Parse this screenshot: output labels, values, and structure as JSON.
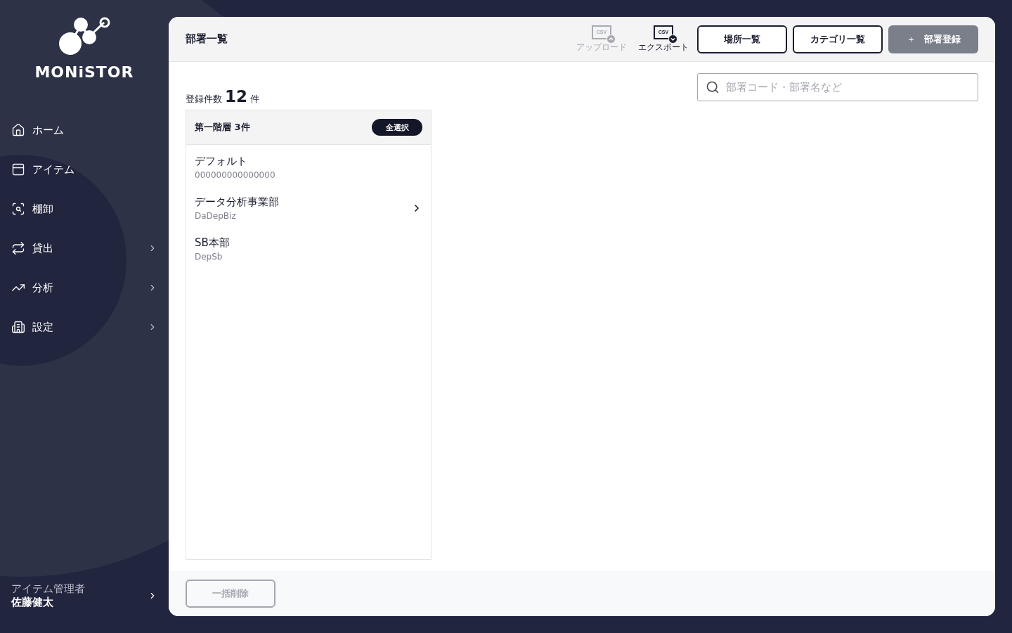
{
  "brand": {
    "name": "MONiSTOR"
  },
  "nav": [
    {
      "kind": "home",
      "label": "ホーム",
      "expandable": false
    },
    {
      "kind": "item",
      "label": "アイテム",
      "expandable": false
    },
    {
      "kind": "inventory",
      "label": "棚卸",
      "expandable": false
    },
    {
      "kind": "lending",
      "label": "貸出",
      "expandable": true
    },
    {
      "kind": "analysis",
      "label": "分析",
      "expandable": true
    },
    {
      "kind": "settings",
      "label": "設定",
      "expandable": true
    }
  ],
  "user": {
    "role": "アイテム管理者",
    "name": "佐藤健太"
  },
  "header": {
    "title": "部署一覧",
    "csv_actions": [
      {
        "kind": "upload",
        "badge": "CSV",
        "label": "アップロード",
        "disabled": true
      },
      {
        "kind": "export",
        "badge": "CSV",
        "label": "エクスポート",
        "disabled": false
      }
    ],
    "buttons": [
      {
        "kind": "outline",
        "label": "場所一覧",
        "disabled": false
      },
      {
        "kind": "outline",
        "label": "カテゴリ一覧",
        "disabled": false
      },
      {
        "kind": "primary",
        "icon": "＋",
        "label": "部署登録",
        "disabled": true
      }
    ]
  },
  "count": {
    "label": "登録件数",
    "value": "12",
    "unit": "件"
  },
  "search": {
    "placeholder": "部署コード・部署名など"
  },
  "level_panel": {
    "title": "第一階層 3件",
    "select_all": "全選択",
    "items": [
      {
        "name": "デフォルト",
        "code": "000000000000000",
        "has_children": false
      },
      {
        "name": "データ分析事業部",
        "code": "DaDepBiz",
        "has_children": true
      },
      {
        "name": "SB本部",
        "code": "DepSb",
        "has_children": false
      }
    ]
  },
  "footer": {
    "bulk_delete": {
      "label": "一括削除",
      "disabled": true
    }
  }
}
